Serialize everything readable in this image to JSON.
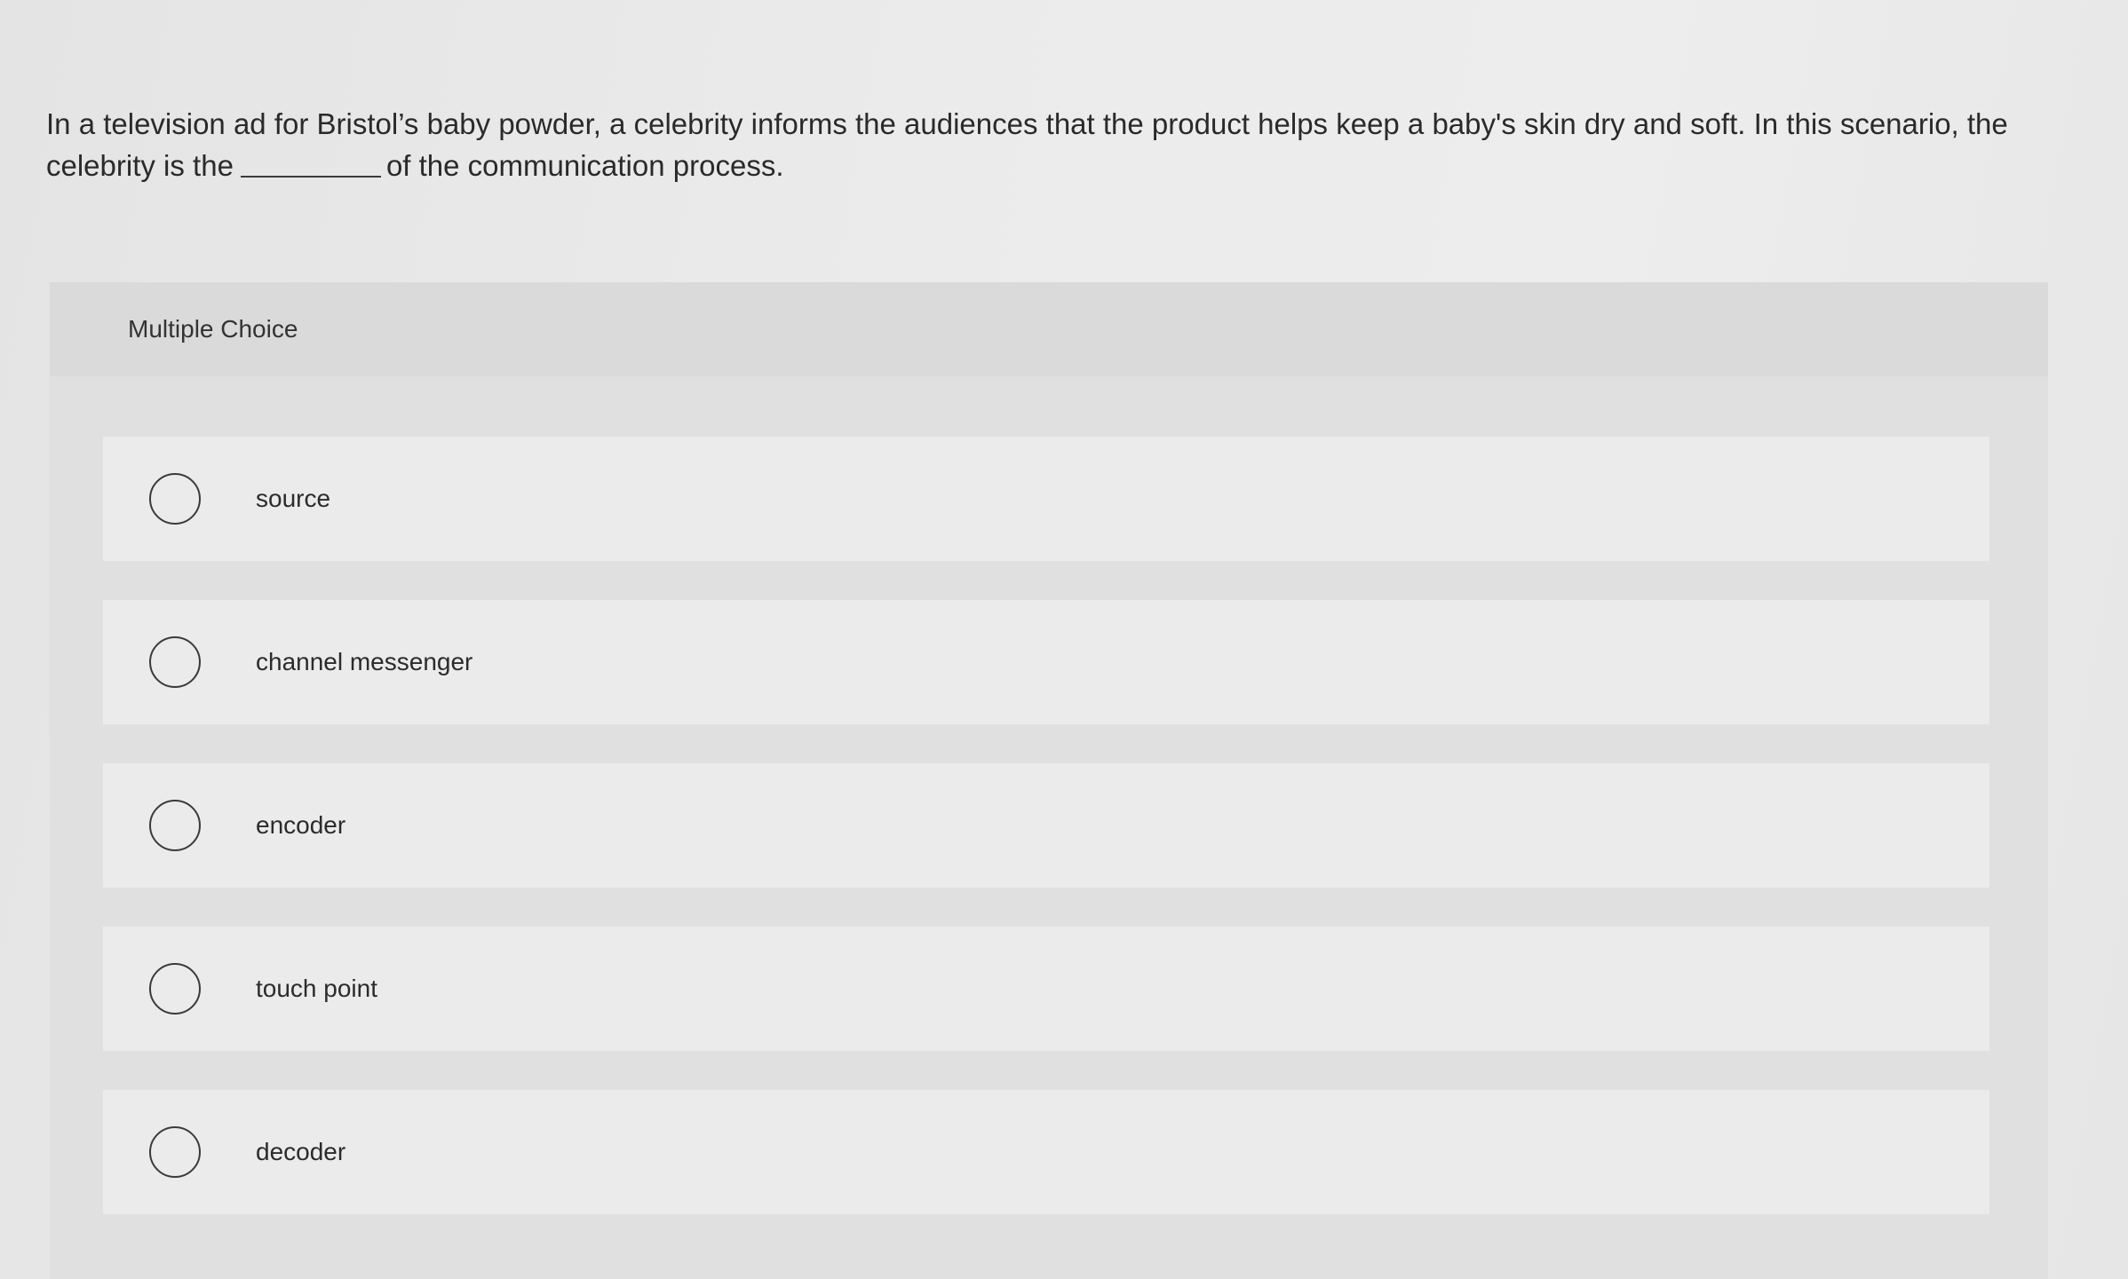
{
  "question": {
    "text_before": "In a television ad for Bristol’s baby powder, a celebrity informs the audiences that the product helps keep a baby's skin dry and soft. In this scenario, the celebrity is the",
    "text_after": "of the communication process."
  },
  "multiple_choice": {
    "header": "Multiple Choice",
    "options": [
      {
        "label": "source",
        "icon": "radio-unselected"
      },
      {
        "label": "channel messenger",
        "icon": "radio-unselected"
      },
      {
        "label": "encoder",
        "icon": "radio-unselected"
      },
      {
        "label": "touch point",
        "icon": "radio-unselected"
      },
      {
        "label": "decoder",
        "icon": "radio-unselected"
      }
    ]
  }
}
